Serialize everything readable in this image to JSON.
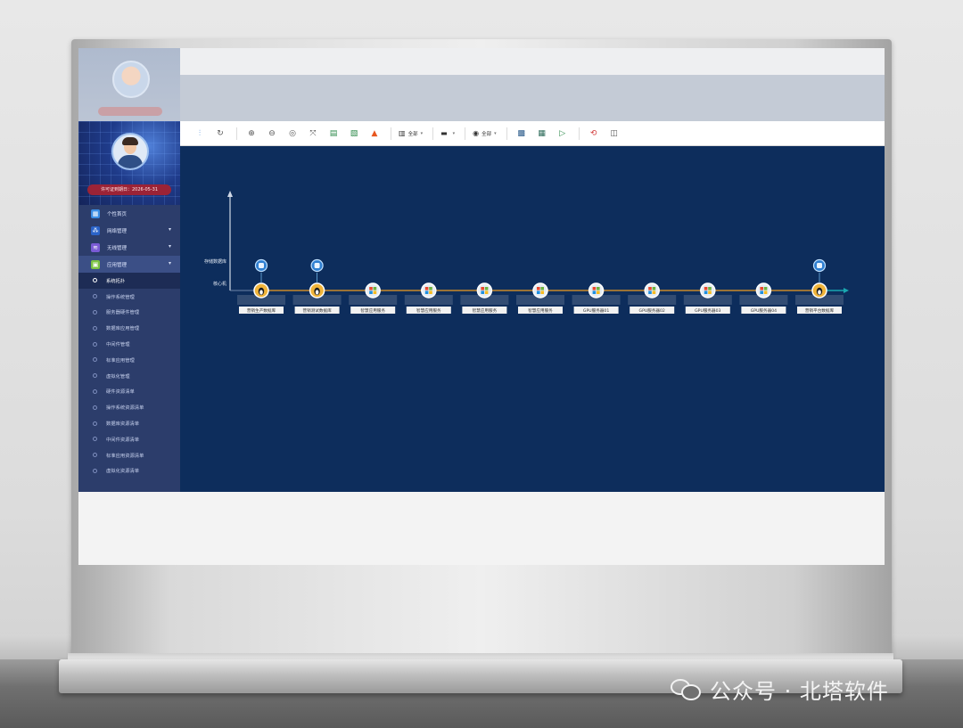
{
  "watermark": {
    "text": "公众号 · 北塔软件"
  },
  "sidebar": {
    "license_text": "许可证到期日：2026-05-31",
    "menu": [
      {
        "label": "个性首页",
        "icon": "home-icon",
        "color": "#3a8ee6",
        "glyph": "▦",
        "has_arrow": false
      },
      {
        "label": "网络管理",
        "icon": "network-icon",
        "color": "#2a63c9",
        "glyph": "⁂",
        "has_arrow": true
      },
      {
        "label": "无线管理",
        "icon": "wireless-icon",
        "color": "#7a5bd6",
        "glyph": "≋",
        "has_arrow": true
      },
      {
        "label": "应用管理",
        "icon": "application-icon",
        "color": "#7cc242",
        "glyph": "▣",
        "has_arrow": true,
        "active": true
      }
    ],
    "submenu": [
      {
        "label": "系统拓扑",
        "selected": true
      },
      {
        "label": "操作系统管理"
      },
      {
        "label": "服务器硬件管理"
      },
      {
        "label": "数据库应用管理"
      },
      {
        "label": "中间件管理"
      },
      {
        "label": "标准应用管理"
      },
      {
        "label": "虚拟化管理"
      },
      {
        "label": "硬件资源清单"
      },
      {
        "label": "操作系统资源清单"
      },
      {
        "label": "数据库资源清单"
      },
      {
        "label": "中间件资源清单"
      },
      {
        "label": "标准应用资源清单"
      },
      {
        "label": "虚拟化资源清单"
      }
    ]
  },
  "toolbar": {
    "buttons": [
      {
        "name": "layout-icon",
        "glyph": "⫶",
        "color": "#1c6fd1"
      },
      {
        "name": "refresh-icon",
        "glyph": "↻",
        "color": "#555555"
      },
      {
        "sep": true
      },
      {
        "name": "zoom-in-icon",
        "glyph": "⊕",
        "color": "#555555"
      },
      {
        "name": "zoom-out-icon",
        "glyph": "⊖",
        "color": "#555555"
      },
      {
        "name": "fit-view-icon",
        "glyph": "◎",
        "color": "#555555"
      },
      {
        "name": "fullscreen-icon",
        "glyph": "⤧",
        "color": "#555555"
      },
      {
        "name": "export-icon",
        "glyph": "▤",
        "color": "#2d8a4b"
      },
      {
        "name": "save-icon",
        "glyph": "▧",
        "color": "#2d8a4b"
      },
      {
        "name": "alarm-icon",
        "glyph": "▲",
        "color": "#e8561f"
      },
      {
        "sep": true
      }
    ],
    "dropdowns": [
      {
        "name": "filter-dropdown",
        "glyph": "▥",
        "label": "全部"
      },
      {
        "name": "display-dropdown",
        "glyph": "▬",
        "label": ""
      },
      {
        "name": "status-dropdown",
        "glyph": "◉",
        "label": "全部"
      }
    ],
    "buttons2": [
      {
        "name": "image-icon",
        "glyph": "▩",
        "color": "#2a5a8a"
      },
      {
        "name": "edit-icon",
        "glyph": "▦",
        "color": "#2d6b5a"
      },
      {
        "name": "play-icon",
        "glyph": "▷",
        "color": "#2d8a4b"
      },
      {
        "sep": true
      },
      {
        "name": "link-icon",
        "glyph": "⟲",
        "color": "#d23a3a"
      },
      {
        "name": "panel-icon",
        "glyph": "◫",
        "color": "#555555"
      }
    ]
  },
  "topology": {
    "axis_labels": [
      "存储数据库",
      "核心机"
    ],
    "nodes": [
      {
        "label": "营销生产数据库",
        "os": "linux",
        "has_db": true
      },
      {
        "label": "营销测试数据库",
        "os": "linux",
        "has_db": true
      },
      {
        "label": "智慧应用服务",
        "os": "windows",
        "has_db": false
      },
      {
        "label": "智慧应用服务",
        "os": "windows",
        "has_db": false
      },
      {
        "label": "智慧应用服务",
        "os": "windows",
        "has_db": false
      },
      {
        "label": "智慧应用服务",
        "os": "windows",
        "has_db": false
      },
      {
        "label": "GPU服务器01",
        "os": "windows",
        "has_db": false
      },
      {
        "label": "GPU服务器02",
        "os": "windows",
        "has_db": false
      },
      {
        "label": "GPU服务器03",
        "os": "windows",
        "has_db": false
      },
      {
        "label": "GPU服务器04",
        "os": "windows",
        "has_db": false
      },
      {
        "label": "营销平台数据库",
        "os": "linux",
        "has_db": true
      }
    ]
  }
}
